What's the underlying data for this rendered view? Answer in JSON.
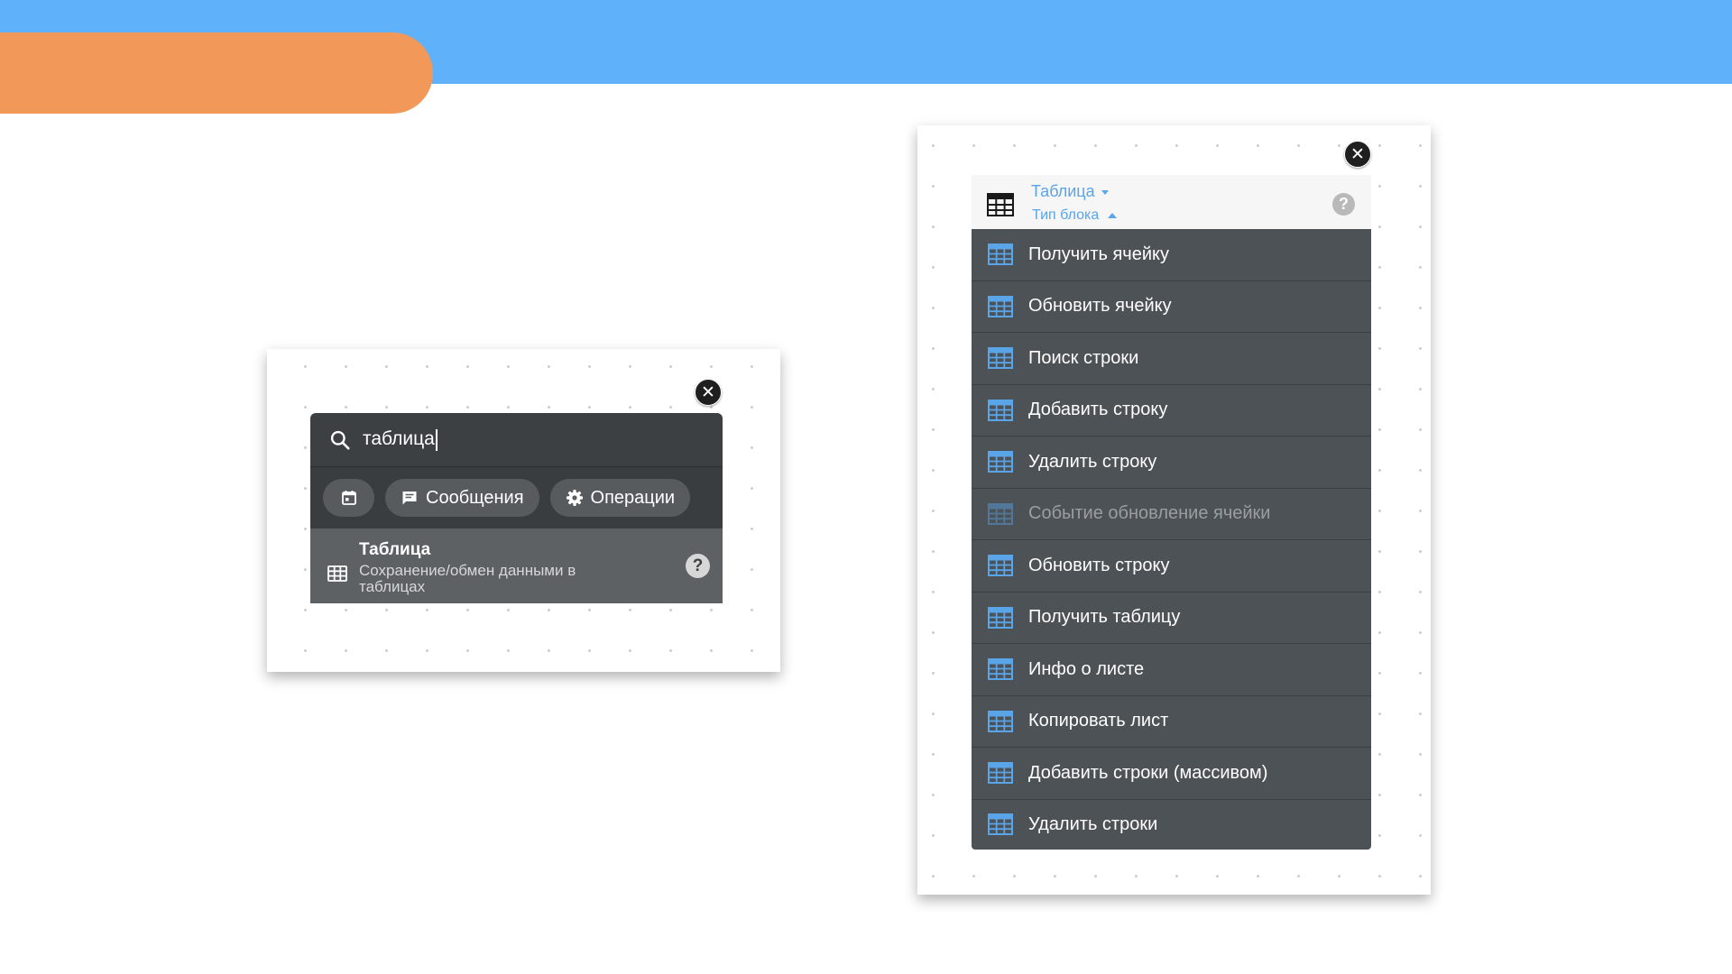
{
  "search_card": {
    "close_icon": "close-icon",
    "search": {
      "icon": "search-icon",
      "value": "таблица"
    },
    "chips": [
      {
        "icon": "calendar-icon",
        "label": ""
      },
      {
        "icon": "message-icon",
        "label": "Сообщения"
      },
      {
        "icon": "gear-icon",
        "label": "Операции"
      }
    ],
    "result": {
      "icon": "table-icon",
      "title": "Таблица",
      "subtitle": "Сохранение/обмен данными в таблицах",
      "help_icon": "help-icon",
      "help_glyph": "?"
    }
  },
  "block_card": {
    "close_icon": "close-icon",
    "header": {
      "icon": "table-icon",
      "block_name": "Таблица",
      "block_type_label": "Тип блока",
      "help_glyph": "?"
    },
    "colors": {
      "accent": "#5aa4e8",
      "menu_bg": "#4d5256",
      "icon_blue": "#5aa4e8"
    },
    "items": [
      {
        "label": "Получить ячейку",
        "disabled": false
      },
      {
        "label": "Обновить ячейку",
        "disabled": false
      },
      {
        "label": "Поиск строки",
        "disabled": false
      },
      {
        "label": "Добавить строку",
        "disabled": false
      },
      {
        "label": "Удалить строку",
        "disabled": false
      },
      {
        "label": "Событие обновление ячейки",
        "disabled": true
      },
      {
        "label": "Обновить строку",
        "disabled": false
      },
      {
        "label": "Получить таблицу",
        "disabled": false
      },
      {
        "label": "Инфо о листе",
        "disabled": false
      },
      {
        "label": "Копировать лист",
        "disabled": false
      },
      {
        "label": "Добавить строки (массивом)",
        "disabled": false
      },
      {
        "label": "Удалить строки",
        "disabled": false
      }
    ]
  }
}
